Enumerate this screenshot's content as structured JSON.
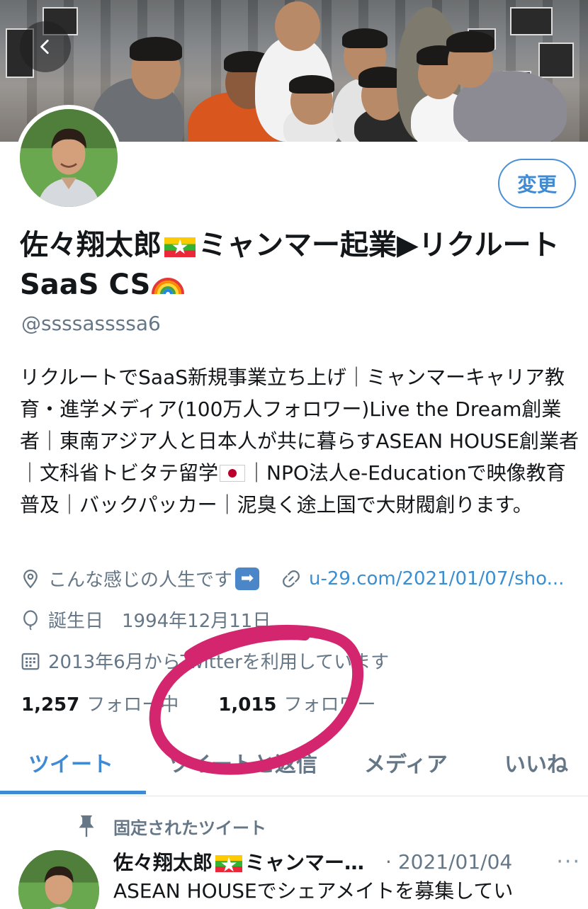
{
  "banner": {
    "description_icon": "group-photo"
  },
  "nav": {
    "back_icon": "chevron-left-icon"
  },
  "profile": {
    "edit_label": "変更",
    "name_part1": "佐々翔太郎",
    "name_part2": "ミャンマー起業▶リクルートSaaS CS",
    "handle": "@ssssassssa6",
    "bio_part1": "リクルートでSaaS新規事業立ち上げ｜ミャンマーキャリア教育・進学メディア(100万人フォロワー)Live the Dream創業者｜東南アジア人と日本人が共に暮らすASEAN HOUSE創業者｜文科省トビタテ留学",
    "bio_part2": "｜NPO法人e-Educationで映像教育普及｜バックパッカー｜泥臭く途上国で大財閥創ります。",
    "location": "こんな感じの人生です",
    "link": "u-29.com/2021/01/07/sho...",
    "birthday_label": "誕生日",
    "birthday": "1994年12月11日",
    "joined": "2013年6月からTwitterを利用しています",
    "following_count": "1,257",
    "following_label": "フォロー中",
    "followers_count": "1,015",
    "followers_label": "フォロワー"
  },
  "tabs": [
    {
      "label": "ツイート",
      "active": true
    },
    {
      "label": "ツイートと返信",
      "active": false
    },
    {
      "label": "メディア",
      "active": false
    },
    {
      "label": "いいね",
      "active": false
    }
  ],
  "pinned_tweet": {
    "pinned_label": "固定されたツイート",
    "author": "佐々翔太郎",
    "author_suffix": "ミャンマー…",
    "date": "· 2021/01/04",
    "more": "···",
    "text": "ASEAN HOUSEでシェアメイトを募集してい"
  },
  "colors": {
    "accent": "#3f8ad4",
    "secondary_text": "#657786",
    "annotation": "#d4266e"
  }
}
